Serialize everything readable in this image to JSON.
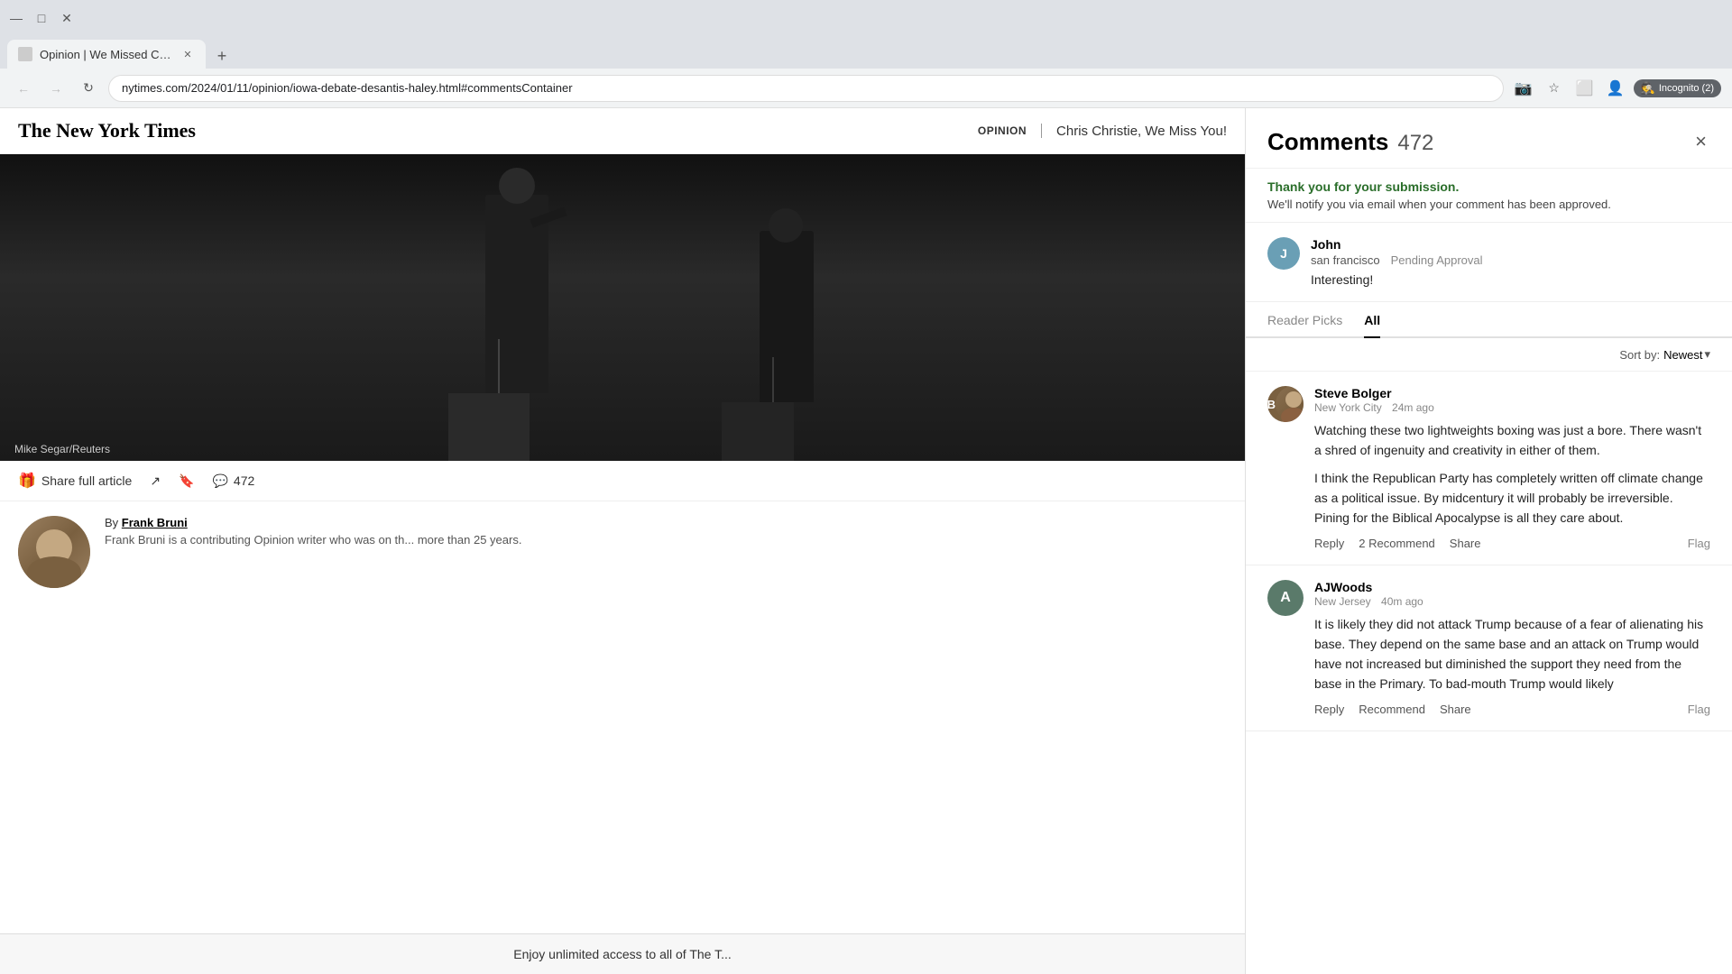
{
  "browser": {
    "tab_title": "Opinion | We Missed Chris Chri...",
    "url": "nytimes.com/2024/01/11/opinion/iowa-debate-desantis-haley.html#commentsContainer",
    "back_btn": "◀",
    "forward_btn": "▶",
    "reload_btn": "↻",
    "incognito_label": "Incognito (2)"
  },
  "header": {
    "logo": "The New York Times",
    "opinion_label": "OPINION",
    "article_title": "Chris Christie, We Miss You!"
  },
  "toolbar": {
    "share_full_article": "Share full article",
    "comment_count": "472"
  },
  "author": {
    "byline_prefix": "By",
    "name": "Frank Bruni",
    "bio": "Frank Bruni is a contributing Opinion writer who was on th... more than 25 years."
  },
  "paywall": {
    "text": "Enjoy unlimited access to all of The T..."
  },
  "image_caption": "Mike Segar/Reuters",
  "comments": {
    "title": "Comments",
    "count": "472",
    "close_label": "×",
    "submission": {
      "thank_you": "Thank you for your submission.",
      "notice": "We'll notify you via email when your comment has been approved."
    },
    "pending_comment": {
      "username": "John",
      "location": "san francisco",
      "status": "Pending Approval",
      "text": "Interesting!"
    },
    "filter_tabs": [
      {
        "label": "Reader Picks",
        "active": false
      },
      {
        "label": "All",
        "active": true
      }
    ],
    "sort": {
      "label": "Sort by:",
      "value": "Newest",
      "chevron": "▾"
    },
    "items": [
      {
        "id": "comment-1",
        "avatar_initials": "SB",
        "avatar_class": "steve",
        "username": "Steve Bolger",
        "location": "New York City",
        "time_ago": "24m ago",
        "paragraphs": [
          "Watching these two lightweights boxing was just a bore. There wasn't a shred of ingenuity and creativity in either of them.",
          "I think the Republican Party has completely written off climate change as a political issue. By midcentury it will probably be irreversible. Pining for the Biblical Apocalypse is all they care about."
        ],
        "actions": {
          "reply": "Reply",
          "recommend": "2 Recommend",
          "share": "Share",
          "flag": "Flag"
        }
      },
      {
        "id": "comment-2",
        "avatar_initials": "A",
        "avatar_class": "aj",
        "username": "AJWoods",
        "location": "New Jersey",
        "time_ago": "40m ago",
        "paragraphs": [
          "It is likely they did not attack Trump because of a fear of alienating his base. They depend on the same base and an attack on Trump would have not increased but diminished the support they need from the base in the Primary. To bad-mouth Trump would likely"
        ],
        "actions": {
          "reply": "Reply",
          "recommend": "Recommend",
          "share": "Share",
          "flag": "Flag"
        }
      }
    ]
  }
}
